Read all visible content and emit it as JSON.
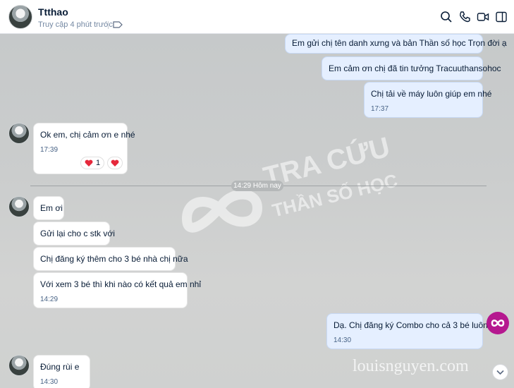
{
  "header": {
    "name": "Ttthao",
    "last_seen": "Truy cập 4 phút trước"
  },
  "messages": {
    "m1": "Em gửi chị tên danh xưng và bản Thần số học Trọn đời ạ",
    "m2": "Em cảm ơn chị đã tin tưởng Tracuuthansohoc",
    "m3": "Chị tải về máy luôn giúp em nhé",
    "m3_time": "17:37",
    "m4": "Ok em, chị cảm ơn e nhé",
    "m4_time": "17:39",
    "m4_reaction_count": "1",
    "divider": "14:29 Hôm nay",
    "m5": "Em ơi",
    "m6": "Gửi lại cho c stk với",
    "m7": "Chị đăng ký thêm cho 3 bé nhà chị nữa",
    "m8": "Với xem 3 bé thì khi nào có kết quả em nhỉ",
    "m8_time": "14:29",
    "m9": "Dạ. Chị đăng ký Combo cho cả 3 bé luôn ạ?",
    "m9_time": "14:30",
    "m10": "Đúng rùi e",
    "m10_time": "14:30"
  },
  "watermark": {
    "line1": "TRA CỨU",
    "line2": "THẦN SỐ HỌC",
    "site": "louisnguyen.com"
  },
  "icons": [
    "search-icon",
    "phone-icon",
    "video-icon",
    "sidebar-toggle-icon",
    "tag-icon",
    "heart-icon",
    "infinity-icon",
    "chevron-down-icon"
  ]
}
